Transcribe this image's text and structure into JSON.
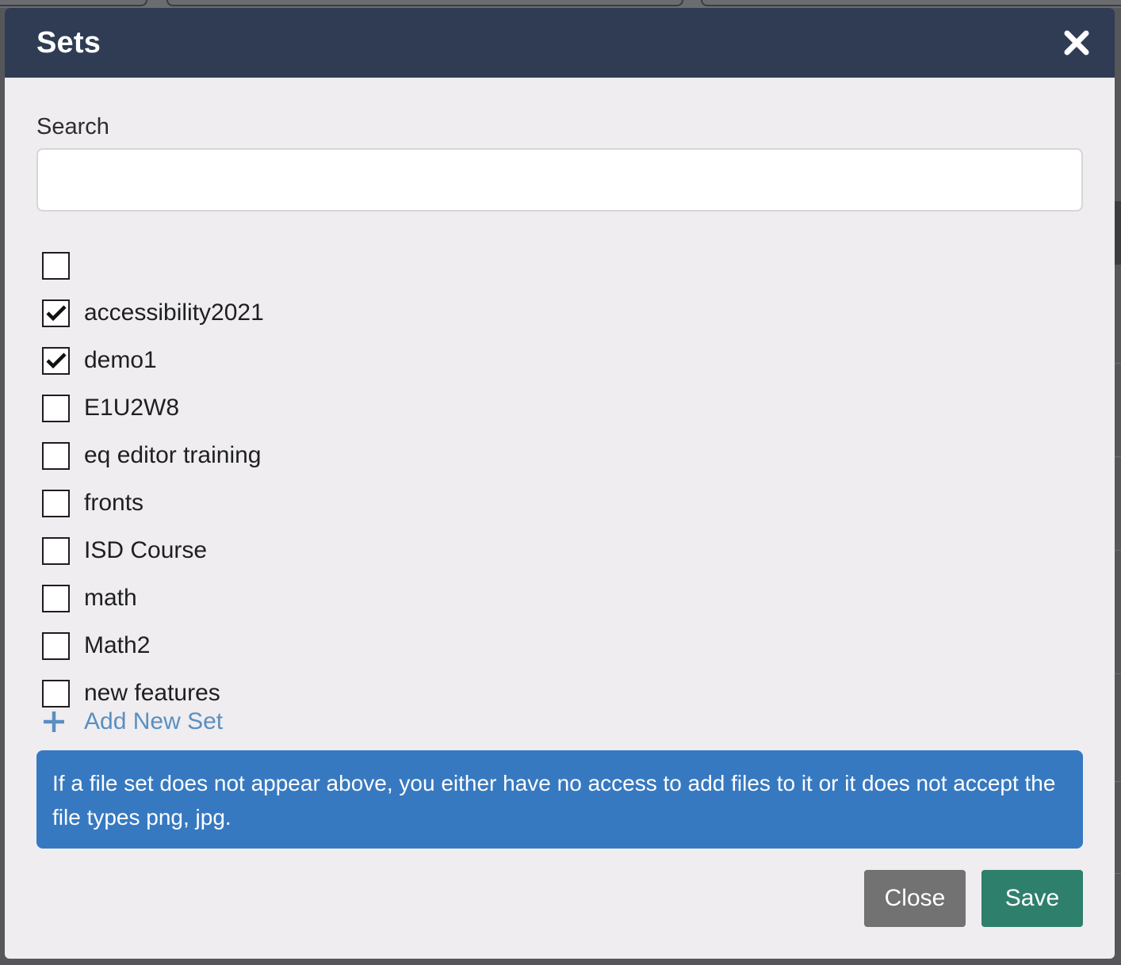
{
  "modal": {
    "title": "Sets",
    "close_icon": "close-icon"
  },
  "search": {
    "label": "Search",
    "value": "",
    "placeholder": ""
  },
  "sets": [
    {
      "label": "",
      "checked": false
    },
    {
      "label": "accessibility2021",
      "checked": true
    },
    {
      "label": "demo1",
      "checked": true
    },
    {
      "label": "E1U2W8",
      "checked": false
    },
    {
      "label": "eq editor training",
      "checked": false
    },
    {
      "label": "fronts",
      "checked": false
    },
    {
      "label": "ISD Course",
      "checked": false
    },
    {
      "label": "math",
      "checked": false
    },
    {
      "label": "Math2",
      "checked": false
    },
    {
      "label": "new features",
      "checked": false
    }
  ],
  "add_set": {
    "icon": "plus-icon",
    "label": "Add New Set"
  },
  "info": {
    "text": "If a file set does not appear above, you either have no access to add files to it or it does not accept the file types png, jpg."
  },
  "buttons": {
    "close": "Close",
    "save": "Save"
  },
  "colors": {
    "header": "#2f3c54",
    "info": "#3779c0",
    "link": "#5a8fc0",
    "close_button": "#727272",
    "save_button": "#2f7f6d"
  }
}
